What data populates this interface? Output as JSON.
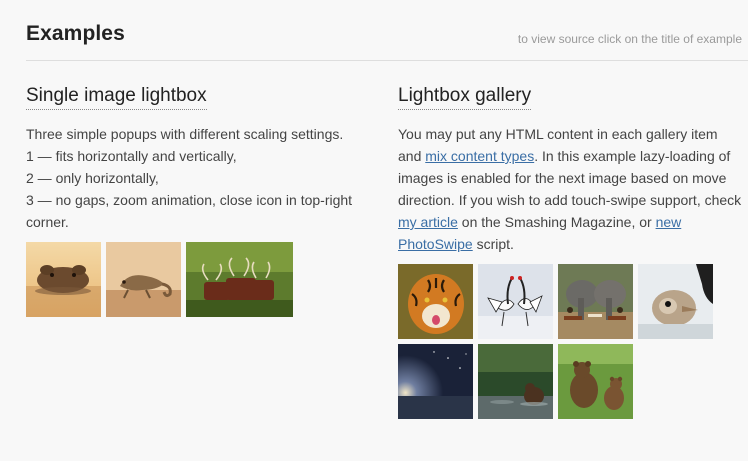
{
  "header": {
    "title": "Examples",
    "hint": "to view source click on the title of example"
  },
  "single": {
    "title": "Single image lightbox",
    "intro": "Three simple popups with different scaling settings.",
    "line1": "1 — fits horizontally and vertically,",
    "line2": "2 — only horizontally,",
    "line3": "3 — no gaps, zoom animation, close icon in top-right corner.",
    "images": [
      "hippo",
      "chameleon",
      "cattle"
    ]
  },
  "gallery": {
    "title": "Lightbox gallery",
    "text_a": "You may put any HTML content in each gallery item and ",
    "link_mix": "mix content types",
    "text_b": ". In this example lazy-loading of images is enabled for the next image based on move direction. If you wish to add touch-swipe support, check ",
    "link_article": "my article",
    "text_c": " on the Smashing Magazine, or ",
    "link_photoswipe": "new PhotoSwipe",
    "text_d": " script.",
    "images": [
      "tiger",
      "cranes",
      "elephants",
      "ostrich",
      "night-sky",
      "bear-water",
      "bears"
    ]
  },
  "colors": {
    "background": "#f8f8f8",
    "link": "#3a6ea5",
    "text": "#444444"
  }
}
